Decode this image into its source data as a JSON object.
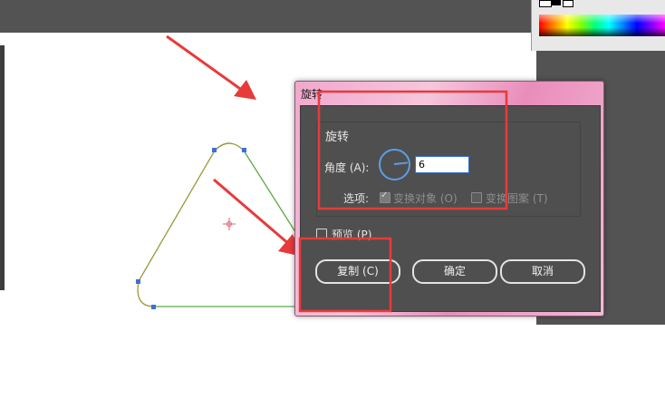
{
  "dialog": {
    "title": "旋转",
    "group_title": "旋转",
    "angle_label": "角度 (A):",
    "angle_value": "6",
    "options_label": "选项:",
    "transform_objects": {
      "label": "变换对象 (O)",
      "checked": true,
      "enabled": false
    },
    "transform_patterns": {
      "label": "变换图案 (T)",
      "checked": false,
      "enabled": false
    },
    "preview": {
      "label": "预览 (P)",
      "checked": false
    },
    "buttons": {
      "copy": "复制 (C)",
      "ok": "确定",
      "cancel": "取消"
    }
  },
  "colors": {
    "annotation": "#e83a3a",
    "selection_handles": "#3f6fd8",
    "dial": "#5aa0e6",
    "dialog_body": "#4f4f4f",
    "title_bar": "#f0a8cc",
    "app_panel": "#535353"
  }
}
